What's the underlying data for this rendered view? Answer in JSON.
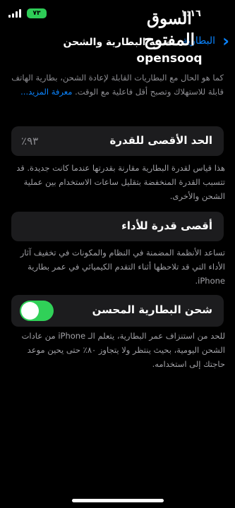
{
  "status_bar": {
    "time": "١:١٦",
    "battery": "٧٣"
  },
  "nav": {
    "back_label": "البطارية",
    "title": "صحة البطارية والشحن"
  },
  "watermark": {
    "arabic": "السوق المفتوح",
    "english": "opensooq"
  },
  "intro": {
    "text": "كما هو الحال مع البطاريات القابلة لإعادة الشحن، بطارية الهاتف قابلة للاستهلاك وتصبح أقل فاعلية مع الوقت.",
    "link": "معرفة المزيد..."
  },
  "max_capacity": {
    "label": "الحد الأقصى للقدرة",
    "value": "٪٩٣",
    "footer": "هذا قياس لقدرة البطارية مقارنة بقدرتها عندما كانت جديدة. قد تتسبب القدرة المنخفضة بتقليل ساعات الاستخدام بين عملية الشحن والأخرى."
  },
  "peak_performance": {
    "label": "أقصى قدرة للأداء",
    "footer": "تساعد الأنظمة المضمنة في النظام والمكونات في تخفيف آثار الأداء التي قد تلاحظها أثناء التقدم الكيميائي في عمر بطارية iPhone."
  },
  "optimized_charging": {
    "label": "شحن البطارية المحسن",
    "enabled": true,
    "footer": "للحد من استنزاف عمر البطارية، يتعلم الـ iPhone من عادات الشحن اليومية، بحيث ينتظر ولا يتجاوز ٨٠٪ حتى يحين موعد حاجتك إلى استخدامه."
  },
  "colors": {
    "background": "#000000",
    "cell": "#1c1c1e",
    "accent": "#0a84ff",
    "toggle_on": "#30d158",
    "secondary_text": "#8e8e93"
  }
}
